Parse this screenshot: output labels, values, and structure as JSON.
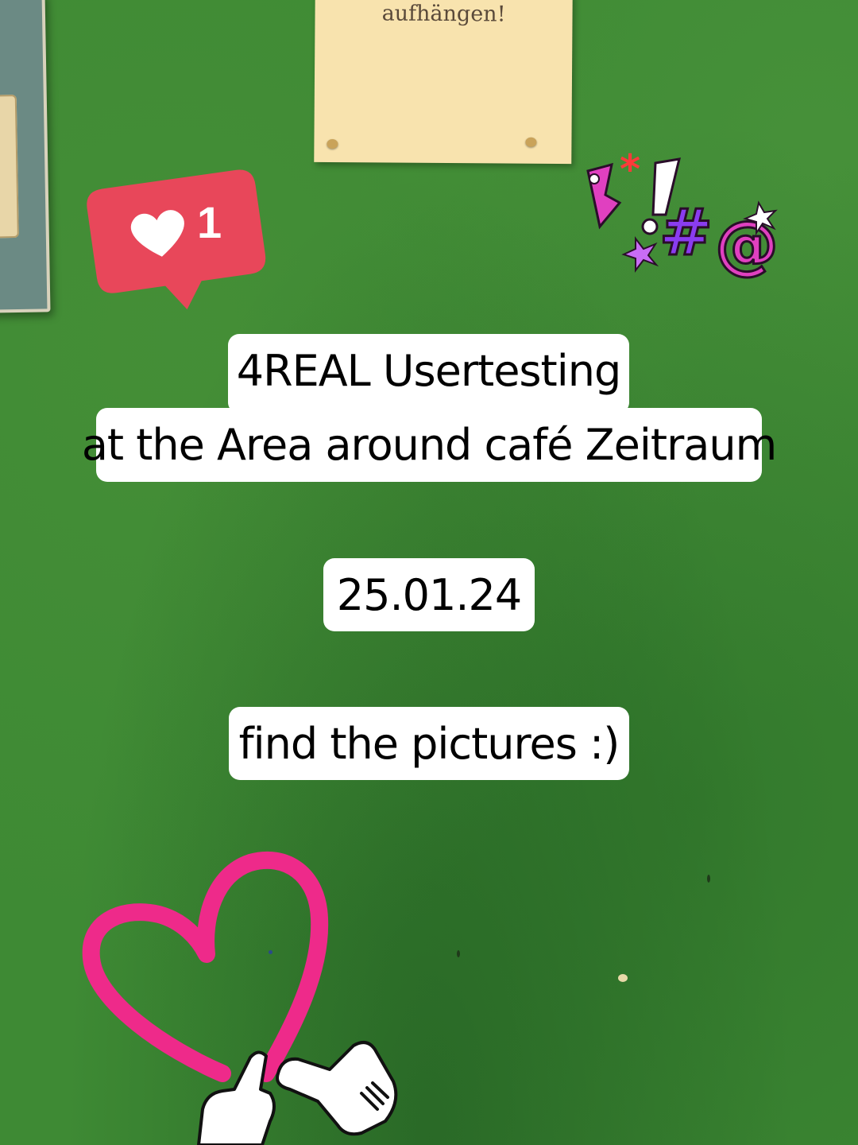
{
  "notice": {
    "text": "aufhängen!"
  },
  "like_sticker": {
    "count": "1",
    "icon": "heart-icon",
    "color": "#e8475a"
  },
  "symbol_sticker": {
    "icon": "grawlix-symbols-icon",
    "colors": [
      "#e040c0",
      "#8a3cf0",
      "#ff3a3a"
    ]
  },
  "post": {
    "title": "4REAL Usertesting",
    "subtitle": "at the Area around café Zeitraum",
    "date": "25.01.24",
    "cta": "find the pictures  :)"
  },
  "heart_sticker": {
    "icon": "outline-heart-icon",
    "color": "#ee2a8a"
  },
  "hands_sticker": {
    "icon": "cartoon-hands-icon"
  },
  "background": {
    "color": "#3e8a34"
  }
}
